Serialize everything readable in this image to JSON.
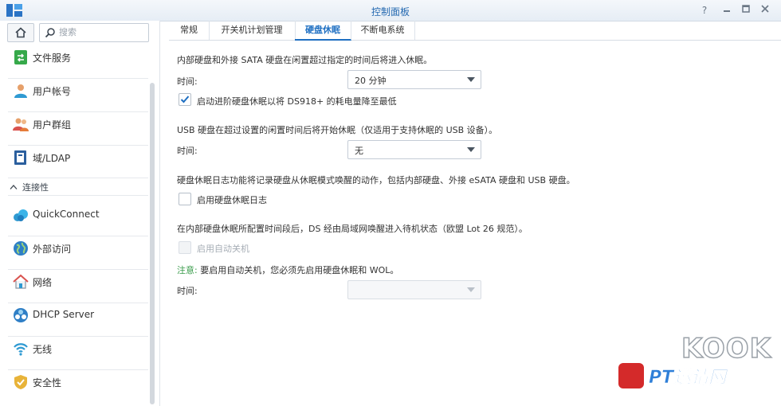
{
  "window": {
    "title": "控制面板"
  },
  "sidebar": {
    "search_placeholder": "搜索",
    "items": [
      {
        "label": "文件服务",
        "icon": "file-services-icon"
      },
      {
        "label": "用户帐号",
        "icon": "user-icon"
      },
      {
        "label": "用户群组",
        "icon": "group-icon"
      },
      {
        "label": "域/LDAP",
        "icon": "domain-icon"
      }
    ],
    "section_label": "连接性",
    "conn_items": [
      {
        "label": "QuickConnect",
        "icon": "quickconnect-icon"
      },
      {
        "label": "外部访问",
        "icon": "globe-icon"
      },
      {
        "label": "网络",
        "icon": "network-home-icon"
      },
      {
        "label": "DHCP Server",
        "icon": "dhcp-icon"
      },
      {
        "label": "无线",
        "icon": "wifi-icon"
      },
      {
        "label": "安全性",
        "icon": "shield-icon"
      }
    ]
  },
  "tabs": [
    "常规",
    "开关机计划管理",
    "硬盘休眠",
    "不断电系统"
  ],
  "active_tab": "硬盘休眠",
  "main": {
    "internal_desc": "内部硬盘和外接 SATA 硬盘在闲置超过指定的时间后将进入休眠。",
    "time_label": "时间:",
    "internal_time": "20 分钟",
    "advanced_hibernation": {
      "label": "启动进阶硬盘休眠以将 DS918+ 的耗电量降至最低",
      "checked": true
    },
    "usb_desc": "USB 硬盘在超过设置的闲置时间后将开始休眠（仅适用于支持休眠的 USB 设备）。",
    "usb_time": "无",
    "log_desc": "硬盘休眠日志功能将记录硬盘从休眠模式唤醒的动作，包括内部硬盘、外接 eSATA 硬盘和 USB 硬盘。",
    "log_checkbox": {
      "label": "启用硬盘休眠日志",
      "checked": false
    },
    "standby_desc": "在内部硬盘休眠所配置时间段后，DS 经由局域网唤醒进入待机状态（欧盟 Lot 26 规范）。",
    "auto_shutdown": {
      "label": "启用自动关机",
      "checked": false,
      "disabled": true
    },
    "note_key": "注意:",
    "note_text": " 要启用自动关机，您必须先启用硬盘休眠和 WOL。",
    "shutdown_time": ""
  },
  "watermark": {
    "line1": "KOOK",
    "line2": "PT邀请网",
    "colors": {
      "red": "#d42a2a",
      "blue": "#2f7fd8"
    }
  }
}
